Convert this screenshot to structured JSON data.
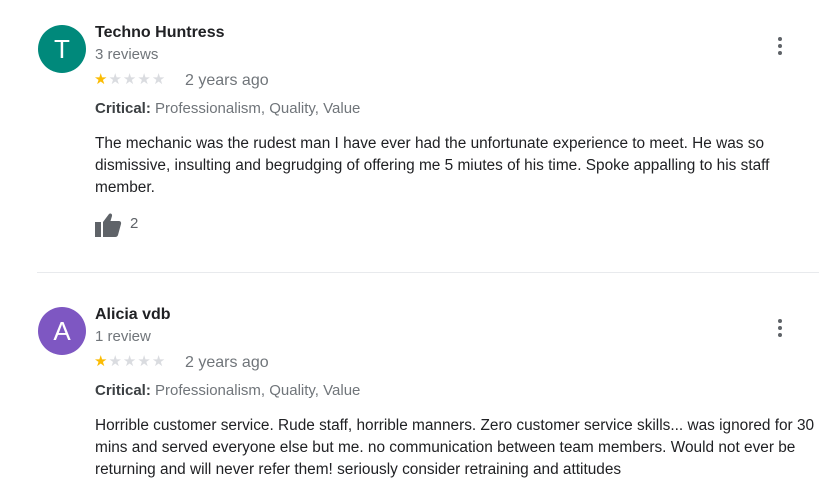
{
  "reviews": [
    {
      "avatar_letter": "T",
      "avatar_color": "#00897b",
      "author": "Techno Huntress",
      "review_count": "3 reviews",
      "rating": 1,
      "rating_max": 5,
      "date": "2 years ago",
      "critical_label": "Critical:",
      "critical_items": "Professionalism, Quality, Value",
      "text": "The mechanic was the rudest man I have ever had the unfortunate experience to meet. He was so dismissive, insulting and begrudging of offering me 5 miutes of his time. Spoke appalling to his staff member.",
      "likes": "2"
    },
    {
      "avatar_letter": "A",
      "avatar_color": "#7e57c2",
      "author": "Alicia vdb",
      "review_count": "1 review",
      "rating": 1,
      "rating_max": 5,
      "date": "2 years ago",
      "critical_label": "Critical:",
      "critical_items": "Professionalism, Quality, Value",
      "text": "Horrible customer service. Rude staff, horrible manners. Zero customer service skills... was ignored for 30 mins and served everyone else but me. no communication between team members. Would not ever be returning and will never refer them! seriously consider retraining and attitudes"
    }
  ],
  "icons": {
    "more": "more-vert-icon",
    "like": "thumb-up-icon",
    "star": "star-icon"
  },
  "colors": {
    "star_filled": "#fbbc04",
    "star_empty": "#dadce0",
    "secondary_text": "#70757a"
  }
}
